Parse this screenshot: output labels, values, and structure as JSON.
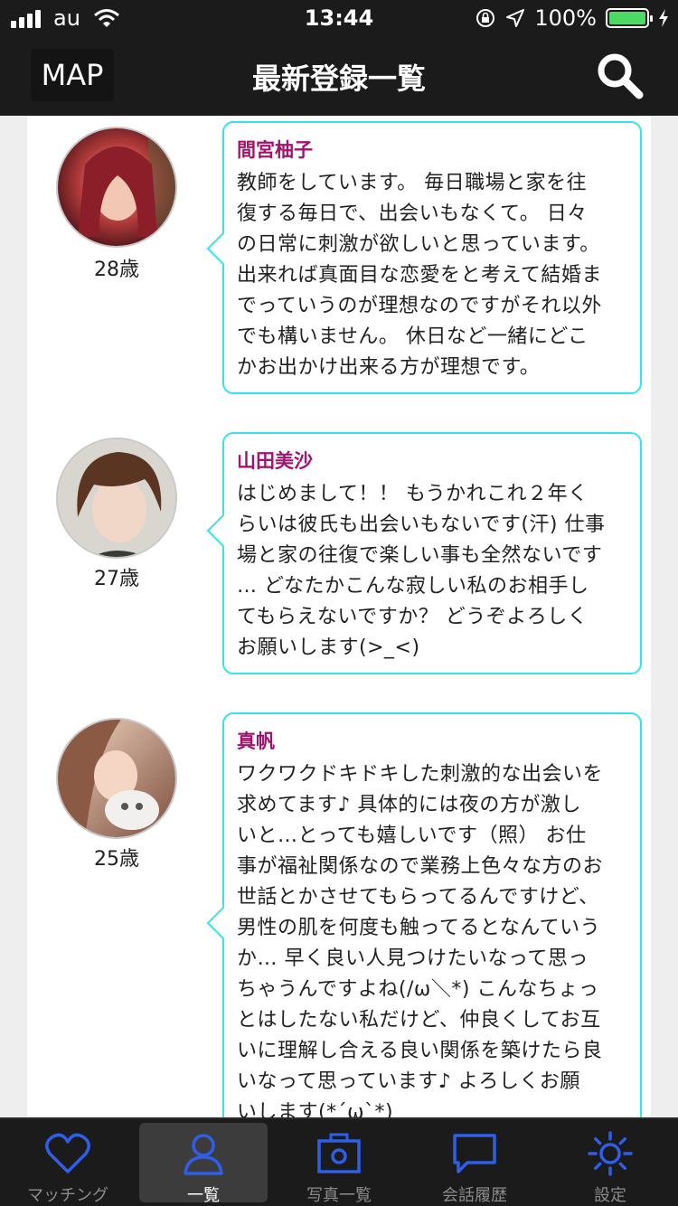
{
  "status_bar": {
    "carrier": "au",
    "time": "13:44",
    "battery_percent": "100%"
  },
  "nav": {
    "map_label": "MAP",
    "title": "最新登録一覧"
  },
  "posts": [
    {
      "name": "間宮柚子",
      "age": "28歳",
      "message_lines": [
        "教師をしています。 毎日職場と家を往",
        "復する毎日で、出会いもなくて。 日々",
        "の日常に刺激が欲しいと思っています。",
        "出来れば真面目な恋愛をと考えて結婚ま",
        "でっていうのが理想なのですがそれ以外",
        "でも構いません。 休日など一緒にどこ",
        "かお出かけ出来る方が理想です。"
      ]
    },
    {
      "name": "山田美沙",
      "age": "27歳",
      "message_lines": [
        "はじめまして！！ もうかれこれ２年く",
        "らいは彼氏も出会いもないです(汗) 仕事",
        "場と家の往復で楽しい事も全然ないです",
        "… どなたかこんな寂しい私のお相手し",
        "てもらえないですか？ どうぞよろしく",
        "お願いします(>_<)"
      ]
    },
    {
      "name": "真帆",
      "age": "25歳",
      "message_lines": [
        "ワクワクドキドキした刺激的な出会いを",
        "求めてます♪ 具体的には夜の方が激し",
        "いと…とっても嬉しいです（照） お仕",
        "事が福祉関係なので業務上色々な方のお",
        "世話とかさせてもらってるんですけど、",
        "男性の肌を何度も触ってるとなんていう",
        "か… 早く良い人見つけたいなって思っ",
        "ちゃうんですよね(/ω＼*) こんなちょっ",
        "とはしたない私だけど、仲良くしてお互",
        "いに理解し合える良い関係を築けたら良",
        "いなって思っています♪ よろしくお願",
        "いします(*´ω`*)"
      ]
    }
  ],
  "tabs": [
    {
      "label": "マッチング",
      "icon": "heart-icon"
    },
    {
      "label": "一覧",
      "icon": "person-icon"
    },
    {
      "label": "写真一覧",
      "icon": "camera-icon"
    },
    {
      "label": "会話履歴",
      "icon": "chat-bubble-icon"
    },
    {
      "label": "設定",
      "icon": "sun-gear-icon"
    }
  ],
  "active_tab": "一覧",
  "colors": {
    "bars": "#1b1b1b",
    "bubble_border": "#35e3ea",
    "name": "#a3136d",
    "icon": "#2f5ee8",
    "battery": "#4cd964"
  }
}
